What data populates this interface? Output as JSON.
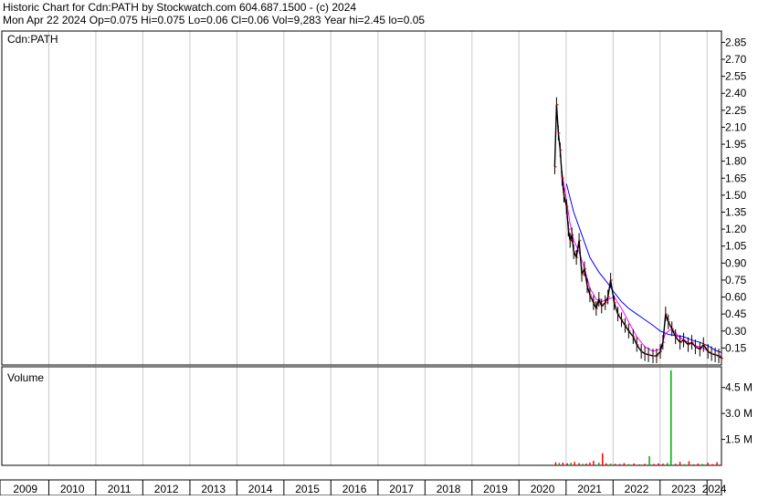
{
  "header": {
    "line1": "Historic Chart for Cdn:PATH by Stockwatch.com 604.687.1500 - (c) 2024",
    "line2": "Mon Apr 22 2024   Op=0.075  Hi=0.075   Lo=0.06  Cl=0.06  Vol=9,283  Year hi=2.45  lo=0.05"
  },
  "chart_data": [
    {
      "type": "line",
      "title": "Cdn:PATH",
      "x_range": [
        "2009-01-01",
        "2024-04-22"
      ],
      "x_ticks": [
        "2009",
        "2010",
        "2011",
        "2012",
        "2013",
        "2014",
        "2015",
        "2016",
        "2017",
        "2018",
        "2019",
        "2020",
        "2021",
        "2022",
        "2023",
        "2024"
      ],
      "y_ticks": [
        "0.15",
        "0.30",
        "0.45",
        "0.60",
        "0.75",
        "0.90",
        "1.05",
        "1.20",
        "1.35",
        "1.50",
        "1.65",
        "1.80",
        "1.95",
        "2.10",
        "2.25",
        "2.40",
        "2.55",
        "2.70",
        "2.85"
      ],
      "ylim": [
        0.0,
        2.95
      ],
      "grid": true,
      "colors": {
        "price": "#000000",
        "close": "#ff0000",
        "ma_short": "#ff00ff",
        "ma_long": "#0000ff"
      },
      "series": [
        {
          "key": "price",
          "x": [
            "2020-10-05",
            "2020-10-19",
            "2020-11-02",
            "2020-11-16",
            "2020-12-01",
            "2020-12-15",
            "2021-01-04",
            "2021-01-18",
            "2021-02-01",
            "2021-02-15",
            "2021-03-01",
            "2021-03-22",
            "2021-04-12",
            "2021-05-03",
            "2021-05-24",
            "2021-06-14",
            "2021-07-05",
            "2021-08-02",
            "2021-08-23",
            "2021-09-13",
            "2021-10-04",
            "2021-11-01",
            "2021-11-22",
            "2021-12-13",
            "2022-01-10",
            "2022-02-07",
            "2022-03-07",
            "2022-04-04",
            "2022-05-02",
            "2022-06-06",
            "2022-07-04",
            "2022-08-08",
            "2022-09-05",
            "2022-10-03",
            "2022-11-07",
            "2022-12-05",
            "2023-01-03",
            "2023-01-23",
            "2023-02-13",
            "2023-03-06",
            "2023-04-03",
            "2023-05-01",
            "2023-06-05",
            "2023-07-03",
            "2023-08-07",
            "2023-09-04",
            "2023-10-02",
            "2023-11-06",
            "2023-12-04",
            "2024-01-08",
            "2024-02-05",
            "2024-03-04",
            "2024-04-01",
            "2024-04-22"
          ],
          "values": [
            1.75,
            2.3,
            2.05,
            1.9,
            1.65,
            1.5,
            1.4,
            1.2,
            1.1,
            1.15,
            1.0,
            0.95,
            1.1,
            0.8,
            0.85,
            0.7,
            0.62,
            0.55,
            0.5,
            0.58,
            0.52,
            0.55,
            0.6,
            0.75,
            0.55,
            0.45,
            0.4,
            0.35,
            0.3,
            0.25,
            0.18,
            0.12,
            0.1,
            0.09,
            0.08,
            0.08,
            0.12,
            0.2,
            0.45,
            0.38,
            0.32,
            0.25,
            0.2,
            0.22,
            0.18,
            0.2,
            0.16,
            0.14,
            0.18,
            0.12,
            0.1,
            0.09,
            0.08,
            0.06
          ]
        },
        {
          "key": "ma_short",
          "x": [
            "2020-12-01",
            "2021-01-04",
            "2021-02-01",
            "2021-03-01",
            "2021-04-12",
            "2021-05-24",
            "2021-07-05",
            "2021-08-23",
            "2021-10-04",
            "2021-11-22",
            "2022-01-10",
            "2022-03-07",
            "2022-05-02",
            "2022-07-04",
            "2022-09-05",
            "2022-11-07",
            "2023-01-03",
            "2023-02-13",
            "2023-04-03",
            "2023-06-05",
            "2023-08-07",
            "2023-10-02",
            "2023-12-04",
            "2024-02-05",
            "2024-04-22"
          ],
          "values": [
            1.7,
            1.45,
            1.25,
            1.1,
            1.0,
            0.85,
            0.68,
            0.58,
            0.56,
            0.58,
            0.6,
            0.5,
            0.38,
            0.25,
            0.16,
            0.12,
            0.14,
            0.28,
            0.32,
            0.24,
            0.2,
            0.17,
            0.15,
            0.1,
            0.07
          ]
        },
        {
          "key": "ma_long",
          "x": [
            "2021-01-04",
            "2021-03-01",
            "2021-05-03",
            "2021-07-05",
            "2021-09-13",
            "2021-11-22",
            "2022-01-10",
            "2022-03-07",
            "2022-05-02",
            "2022-07-04",
            "2022-09-05",
            "2022-11-07",
            "2023-01-03",
            "2023-03-06",
            "2023-05-01",
            "2023-07-03",
            "2023-09-04",
            "2023-11-06",
            "2024-01-08",
            "2024-03-04",
            "2024-04-22"
          ],
          "values": [
            1.6,
            1.35,
            1.15,
            0.95,
            0.82,
            0.72,
            0.64,
            0.56,
            0.5,
            0.45,
            0.4,
            0.35,
            0.3,
            0.27,
            0.26,
            0.25,
            0.22,
            0.2,
            0.17,
            0.13,
            0.11
          ]
        }
      ]
    },
    {
      "type": "bar",
      "title": "Volume",
      "y_ticks": [
        "1.5 M",
        "3.0 M",
        "4.5 M"
      ],
      "ylim": [
        0,
        5700000
      ],
      "colors": {
        "down": "#ff0000",
        "up": "#00aa00",
        "flat": "#000000"
      },
      "bars": [
        {
          "x": "2020-10-12",
          "v": 180000,
          "c": "down"
        },
        {
          "x": "2020-11-09",
          "v": 140000,
          "c": "up"
        },
        {
          "x": "2020-12-07",
          "v": 160000,
          "c": "down"
        },
        {
          "x": "2021-01-11",
          "v": 120000,
          "c": "down"
        },
        {
          "x": "2021-02-08",
          "v": 150000,
          "c": "up"
        },
        {
          "x": "2021-03-08",
          "v": 200000,
          "c": "down"
        },
        {
          "x": "2021-04-12",
          "v": 130000,
          "c": "down"
        },
        {
          "x": "2021-05-10",
          "v": 90000,
          "c": "up"
        },
        {
          "x": "2021-06-07",
          "v": 110000,
          "c": "down"
        },
        {
          "x": "2021-07-05",
          "v": 160000,
          "c": "down"
        },
        {
          "x": "2021-08-02",
          "v": 260000,
          "c": "down"
        },
        {
          "x": "2021-09-13",
          "v": 150000,
          "c": "up"
        },
        {
          "x": "2021-10-11",
          "v": 700000,
          "c": "down"
        },
        {
          "x": "2021-11-08",
          "v": 120000,
          "c": "down"
        },
        {
          "x": "2021-12-13",
          "v": 100000,
          "c": "up"
        },
        {
          "x": "2022-01-17",
          "v": 90000,
          "c": "down"
        },
        {
          "x": "2022-02-21",
          "v": 80000,
          "c": "down"
        },
        {
          "x": "2022-03-28",
          "v": 130000,
          "c": "down"
        },
        {
          "x": "2022-05-02",
          "v": 70000,
          "c": "up"
        },
        {
          "x": "2022-06-13",
          "v": 110000,
          "c": "down"
        },
        {
          "x": "2022-07-25",
          "v": 60000,
          "c": "down"
        },
        {
          "x": "2022-09-05",
          "v": 90000,
          "c": "down"
        },
        {
          "x": "2022-10-10",
          "v": 530000,
          "c": "up"
        },
        {
          "x": "2022-11-14",
          "v": 80000,
          "c": "down"
        },
        {
          "x": "2022-12-19",
          "v": 120000,
          "c": "down"
        },
        {
          "x": "2023-01-23",
          "v": 100000,
          "c": "down"
        },
        {
          "x": "2023-02-27",
          "v": 140000,
          "c": "up"
        },
        {
          "x": "2023-03-27",
          "v": 5500000,
          "c": "up"
        },
        {
          "x": "2023-05-01",
          "v": 90000,
          "c": "down"
        },
        {
          "x": "2023-06-05",
          "v": 200000,
          "c": "down"
        },
        {
          "x": "2023-07-10",
          "v": 70000,
          "c": "up"
        },
        {
          "x": "2023-08-14",
          "v": 240000,
          "c": "down"
        },
        {
          "x": "2023-09-18",
          "v": 60000,
          "c": "down"
        },
        {
          "x": "2023-10-23",
          "v": 110000,
          "c": "down"
        },
        {
          "x": "2023-11-27",
          "v": 80000,
          "c": "up"
        },
        {
          "x": "2024-01-08",
          "v": 150000,
          "c": "down"
        },
        {
          "x": "2024-02-12",
          "v": 70000,
          "c": "down"
        },
        {
          "x": "2024-03-18",
          "v": 180000,
          "c": "down"
        },
        {
          "x": "2024-04-15",
          "v": 40000,
          "c": "down"
        }
      ]
    }
  ]
}
